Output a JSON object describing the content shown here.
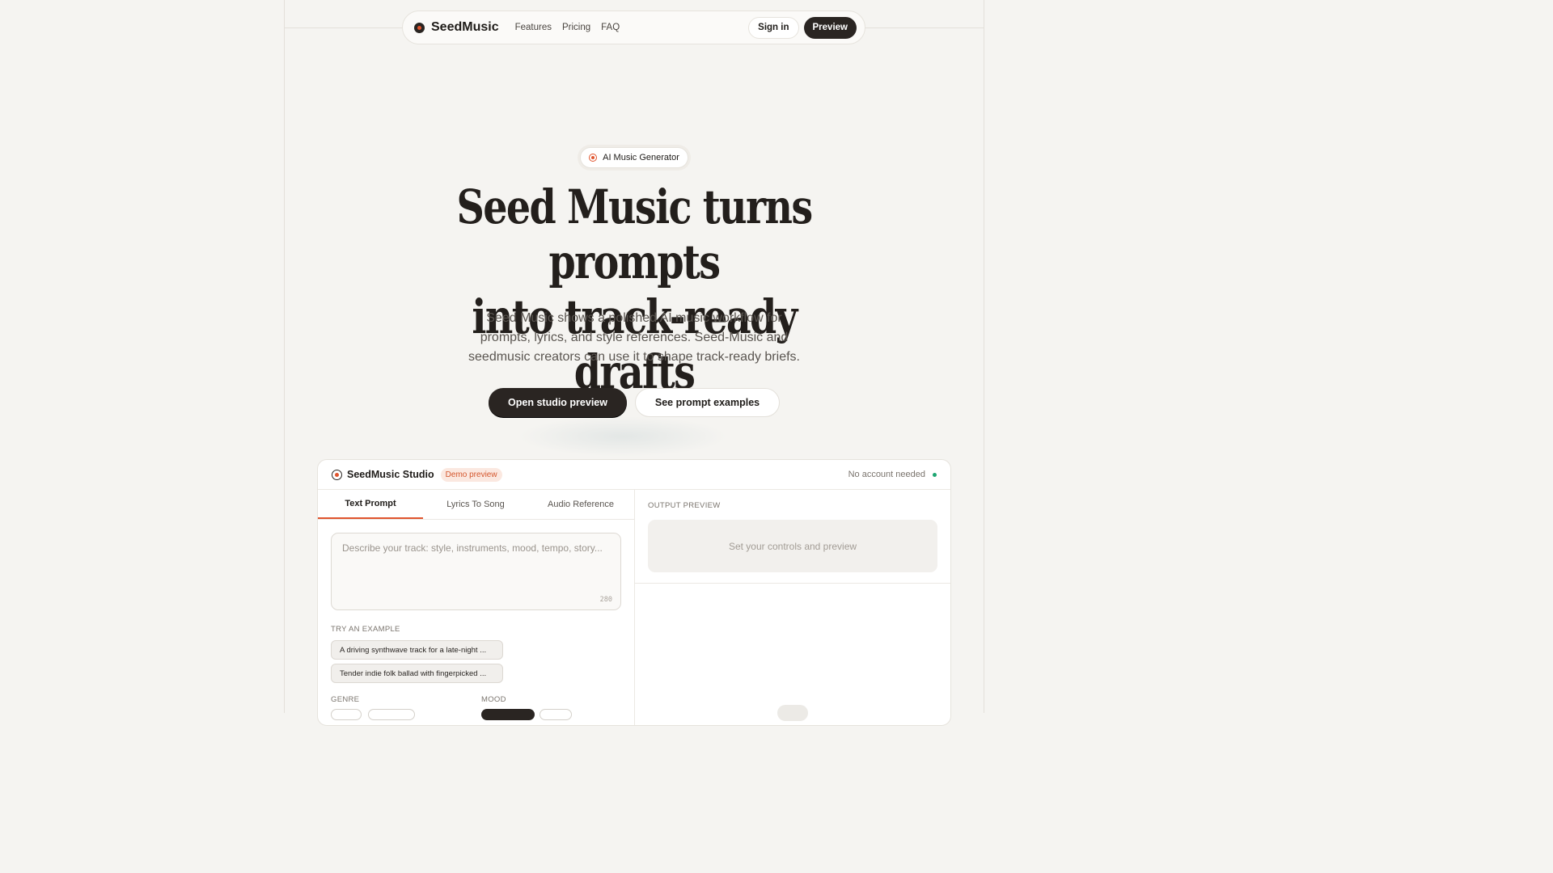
{
  "nav": {
    "brand": "SeedMusic",
    "links": [
      "Features",
      "Pricing",
      "FAQ"
    ],
    "signin": "Sign in",
    "preview": "Preview"
  },
  "hero": {
    "pill": "AI Music Generator",
    "title_line1": "Seed Music turns prompts",
    "title_line2": "into track-ready drafts",
    "subtitle": "Seed Music shows a polished AI music workflow for prompts, lyrics, and style references. Seed-Music and seedmusic creators can use it to shape track-ready briefs.",
    "cta_primary": "Open studio preview",
    "cta_secondary": "See prompt examples"
  },
  "studio": {
    "name": "SeedMusic Studio",
    "badge": "Demo preview",
    "status": "No account needed",
    "tabs": [
      "Text Prompt",
      "Lyrics To Song",
      "Audio Reference"
    ],
    "prompt_placeholder": "Describe your track: style, instruments, mood, tempo, story...",
    "char_count": "280",
    "examples_label": "TRY AN EXAMPLE",
    "examples": [
      "A driving synthwave track for a late-night ...",
      "Tender indie folk ballad with fingerpicked ..."
    ],
    "genre_label": "GENRE",
    "mood_label": "MOOD",
    "output_label": "OUTPUT PREVIEW",
    "output_placeholder": "Set your controls and preview"
  },
  "colors": {
    "accent": "#e0542d",
    "dark": "#2a2522",
    "status_green": "#1ea672",
    "background": "#f5f4f1"
  }
}
